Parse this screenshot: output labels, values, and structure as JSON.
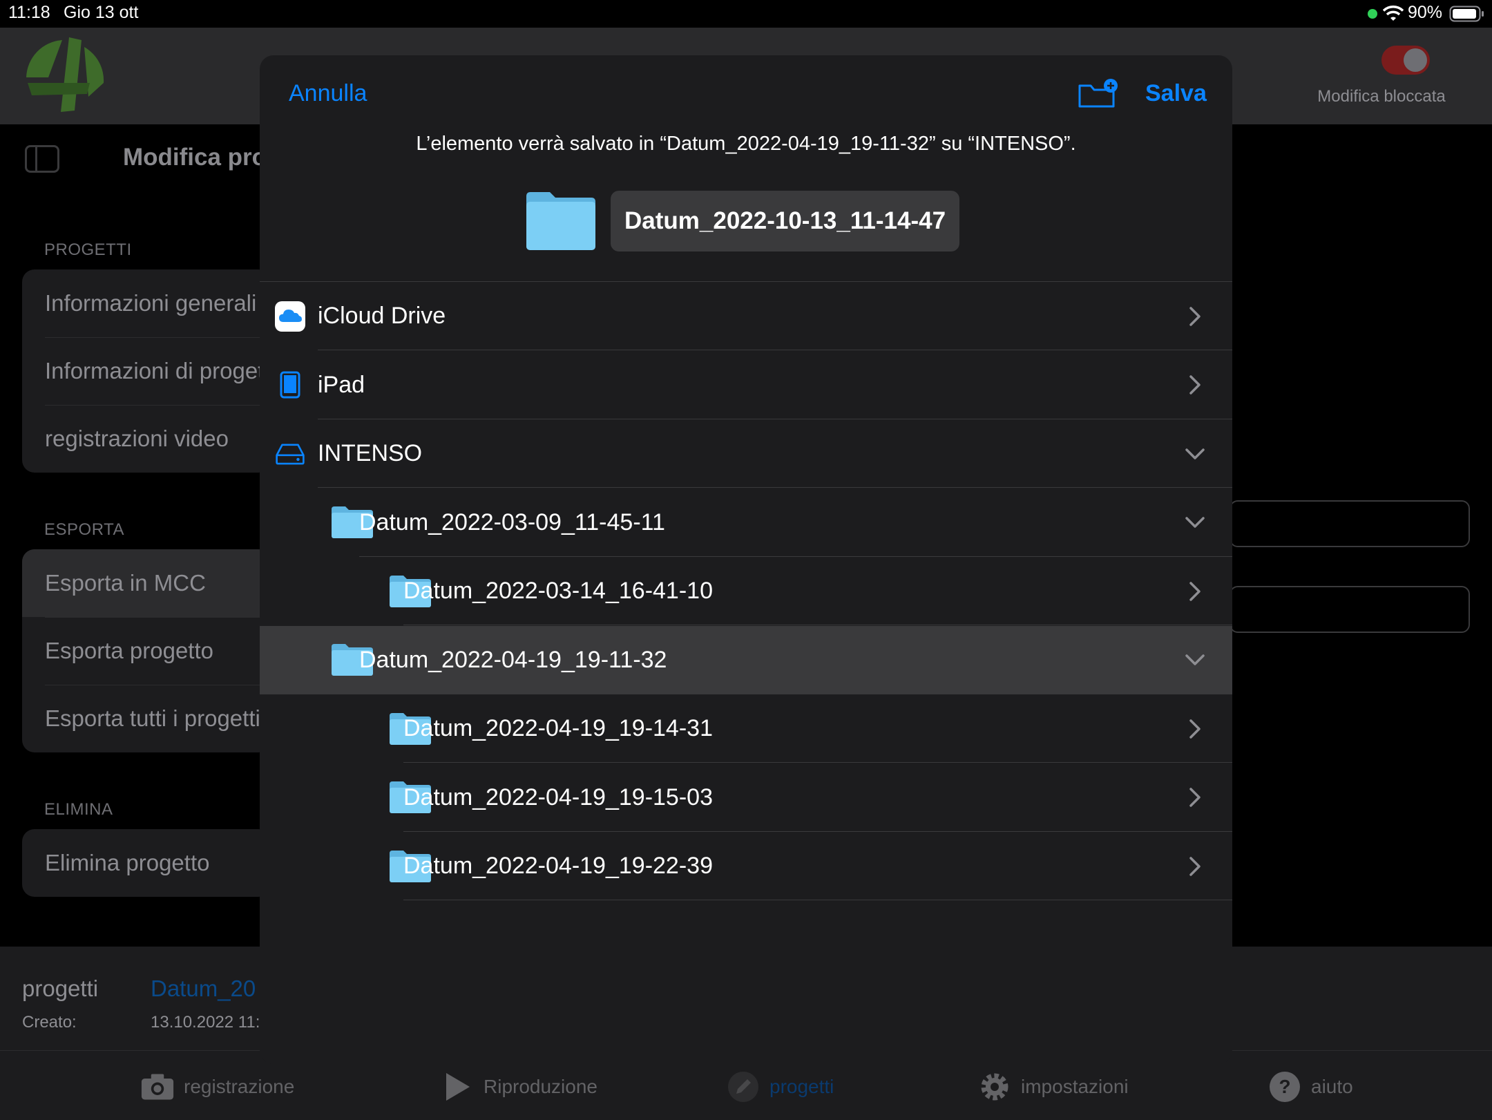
{
  "status": {
    "time": "11:18",
    "date": "Gio 13 ott",
    "battery": "90%"
  },
  "background": {
    "title": "Modifica pro",
    "lock_label": "Modifica bloccata",
    "sections": [
      {
        "header": "PROGETTI",
        "items": [
          "Informazioni generali",
          "Informazioni di progetto",
          "registrazioni video"
        ]
      },
      {
        "header": "ESPORTA",
        "items": [
          "Esporta in MCC",
          "Esporta progetto",
          "Esporta tutti i progetti"
        ]
      },
      {
        "header": "ELIMINA",
        "items": [
          "Elimina progetto"
        ]
      }
    ],
    "footer": {
      "label": "progetti",
      "created_label": "Creato:",
      "project_name": "Datum_20",
      "created_value": "13.10.2022 11:"
    },
    "tabs": [
      "registrazione",
      "Riproduzione",
      "progetti",
      "impostazioni",
      "aiuto"
    ]
  },
  "modal": {
    "cancel": "Annulla",
    "save": "Salva",
    "message": "L’elemento verrà salvato in “Datum_2022-04-19_19-11-32” su “INTENSO”.",
    "file_name": "Datum_2022-10-13_11-14-47",
    "locations": [
      {
        "label": "iCloud Drive",
        "icon": "icloud-icon",
        "expanded": false
      },
      {
        "label": "iPad",
        "icon": "ipad-icon",
        "expanded": false
      },
      {
        "label": "INTENSO",
        "icon": "drive-icon",
        "expanded": true
      },
      {
        "label": "Datum_2022-03-09_11-45-11",
        "icon": "folder-icon",
        "expanded": true
      },
      {
        "label": "Datum_2022-03-14_16-41-10",
        "icon": "folder-icon",
        "expanded": false
      },
      {
        "label": "Datum_2022-04-19_19-11-32",
        "icon": "folder-icon",
        "expanded": true,
        "selected": true
      },
      {
        "label": "Datum_2022-04-19_19-14-31",
        "icon": "folder-icon",
        "expanded": false
      },
      {
        "label": "Datum_2022-04-19_19-15-03",
        "icon": "folder-icon",
        "expanded": false
      },
      {
        "label": "Datum_2022-04-19_19-22-39",
        "icon": "folder-icon",
        "expanded": false
      }
    ]
  },
  "colors": {
    "accent": "#0a84ff",
    "sheet": "#1c1c1e",
    "highlight": "#3a3a3c",
    "folder": "#7ccff5"
  }
}
